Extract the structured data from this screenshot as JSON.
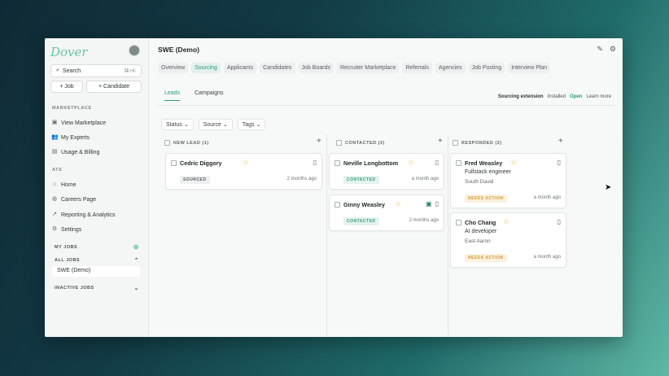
{
  "sidebar": {
    "logo": "Dover",
    "search_label": "Search",
    "search_shortcut": "⌘+K",
    "add_job": "+ Job",
    "add_candidate": "+ Candidate",
    "marketplace_title": "MARKETPLACE",
    "marketplace_items": [
      "View Marketplace",
      "My Experts",
      "Usage & Billing"
    ],
    "ats_title": "ATS",
    "ats_items": [
      "Home",
      "Careers Page",
      "Reporting & Analytics",
      "Settings"
    ],
    "my_jobs": "MY JOBS",
    "all_jobs": "ALL JOBS",
    "current_job": "SWE (Demo)",
    "inactive_jobs": "INACTIVE JOBS"
  },
  "header": {
    "title": "SWE (Demo)",
    "tabs": [
      "Overview",
      "Sourcing",
      "Applicants",
      "Candidates",
      "Job Boards",
      "Recruiter Marketplace",
      "Referrals",
      "Agencies",
      "Job Posting",
      "Interview Plan"
    ],
    "active_tab": "Sourcing"
  },
  "subtabs": {
    "items": [
      "Leads",
      "Campaigns"
    ],
    "active": "Leads",
    "extension_label": "Sourcing extension",
    "extension_status": "Installed",
    "open": "Open",
    "learn_more": "Learn more"
  },
  "filters": [
    "Status",
    "Source",
    "Tags"
  ],
  "columns": [
    {
      "title": "NEW LEAD (1)",
      "cards": [
        {
          "name": "Cedric Diggory",
          "badge": "SOURCED",
          "time": "2 months ago"
        }
      ]
    },
    {
      "title": "CONTACTED (2)",
      "cards": [
        {
          "name": "Neville Longbottom",
          "badge": "CONTACTED",
          "time": "a month ago"
        },
        {
          "name": "Ginny Weasley",
          "badge": "CONTACTED",
          "time": "2 months ago"
        }
      ]
    },
    {
      "title": "RESPONDED (2)",
      "cards": [
        {
          "name": "Fred Weasley",
          "role": "Fullstack engineer",
          "location": "South David",
          "badge": "NEEDS ACTION",
          "time": "a month ago"
        },
        {
          "name": "Cho Chang",
          "role": "AI developer",
          "location": "East Aaron",
          "badge": "NEEDS ACTION",
          "time": "a month ago"
        }
      ]
    }
  ],
  "colors": {
    "accent": "#2c9a7a",
    "star": "#e7b93a",
    "needs_action": "#d39a35"
  }
}
